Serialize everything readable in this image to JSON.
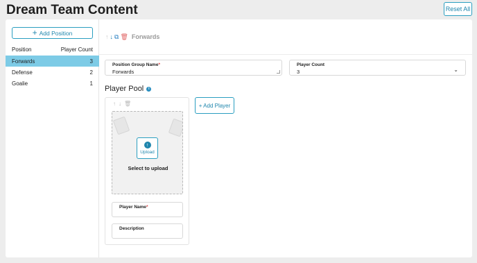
{
  "page": {
    "title": "Dream Team Content",
    "reset_label": "Reset All"
  },
  "sidebar": {
    "add_label": "Add Position",
    "col_position": "Position",
    "col_count": "Player Count",
    "positions": [
      {
        "name": "Forwards",
        "count": "3",
        "selected": true
      },
      {
        "name": "Defense",
        "count": "2",
        "selected": false
      },
      {
        "name": "Goalie",
        "count": "1",
        "selected": false
      }
    ]
  },
  "toolbar": {
    "group_name": "Forwards"
  },
  "form": {
    "group_name_label": "Position Group Name",
    "group_name_value": "Forwards",
    "count_label": "Player Count",
    "count_value": "3"
  },
  "pool": {
    "title": "Player Pool",
    "upload_label": "Upload",
    "upload_caption": "Select to upload",
    "player_name_label": "Player Name",
    "description_label": "Description",
    "add_player_label": "+ Add Player"
  },
  "icons": [
    "arrow-up-icon",
    "arrow-down-icon",
    "duplicate-icon",
    "trash-icon",
    "info-icon",
    "upload-icon",
    "chevron-down-icon",
    "plus-icon"
  ],
  "colors": {
    "accent": "#2a9ec0",
    "selected_row": "#7dcbe6",
    "delete": "#e06464"
  }
}
